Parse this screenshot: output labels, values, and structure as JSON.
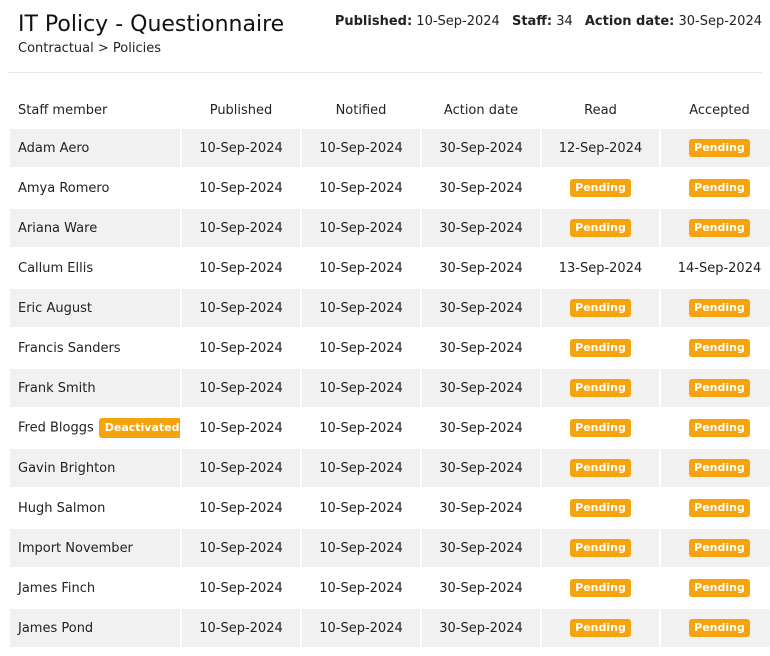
{
  "header": {
    "title": "IT Policy - Questionnaire",
    "breadcrumb": "Contractual > Policies",
    "published_label": "Published:",
    "published_value": "10-Sep-2024",
    "staff_label": "Staff:",
    "staff_value": "34",
    "action_label": "Action date:",
    "action_value": "30-Sep-2024"
  },
  "table": {
    "columns": [
      "Staff member",
      "Published",
      "Notified",
      "Action date",
      "Read",
      "Accepted"
    ],
    "rows": [
      {
        "name": "Adam Aero",
        "badge": "",
        "published": "10-Sep-2024",
        "notified": "10-Sep-2024",
        "action": "30-Sep-2024",
        "read": "12-Sep-2024",
        "read_pending": false,
        "accepted": "Pending",
        "accepted_pending": true
      },
      {
        "name": "Amya Romero",
        "badge": "",
        "published": "10-Sep-2024",
        "notified": "10-Sep-2024",
        "action": "30-Sep-2024",
        "read": "Pending",
        "read_pending": true,
        "accepted": "Pending",
        "accepted_pending": true
      },
      {
        "name": "Ariana Ware",
        "badge": "",
        "published": "10-Sep-2024",
        "notified": "10-Sep-2024",
        "action": "30-Sep-2024",
        "read": "Pending",
        "read_pending": true,
        "accepted": "Pending",
        "accepted_pending": true
      },
      {
        "name": "Callum Ellis",
        "badge": "",
        "published": "10-Sep-2024",
        "notified": "10-Sep-2024",
        "action": "30-Sep-2024",
        "read": "13-Sep-2024",
        "read_pending": false,
        "accepted": "14-Sep-2024",
        "accepted_pending": false
      },
      {
        "name": "Eric August",
        "badge": "",
        "published": "10-Sep-2024",
        "notified": "10-Sep-2024",
        "action": "30-Sep-2024",
        "read": "Pending",
        "read_pending": true,
        "accepted": "Pending",
        "accepted_pending": true
      },
      {
        "name": "Francis Sanders",
        "badge": "",
        "published": "10-Sep-2024",
        "notified": "10-Sep-2024",
        "action": "30-Sep-2024",
        "read": "Pending",
        "read_pending": true,
        "accepted": "Pending",
        "accepted_pending": true
      },
      {
        "name": "Frank Smith",
        "badge": "",
        "published": "10-Sep-2024",
        "notified": "10-Sep-2024",
        "action": "30-Sep-2024",
        "read": "Pending",
        "read_pending": true,
        "accepted": "Pending",
        "accepted_pending": true
      },
      {
        "name": "Fred Bloggs",
        "badge": "Deactivated",
        "published": "10-Sep-2024",
        "notified": "10-Sep-2024",
        "action": "30-Sep-2024",
        "read": "Pending",
        "read_pending": true,
        "accepted": "Pending",
        "accepted_pending": true
      },
      {
        "name": "Gavin Brighton",
        "badge": "",
        "published": "10-Sep-2024",
        "notified": "10-Sep-2024",
        "action": "30-Sep-2024",
        "read": "Pending",
        "read_pending": true,
        "accepted": "Pending",
        "accepted_pending": true
      },
      {
        "name": "Hugh Salmon",
        "badge": "",
        "published": "10-Sep-2024",
        "notified": "10-Sep-2024",
        "action": "30-Sep-2024",
        "read": "Pending",
        "read_pending": true,
        "accepted": "Pending",
        "accepted_pending": true
      },
      {
        "name": "Import November",
        "badge": "",
        "published": "10-Sep-2024",
        "notified": "10-Sep-2024",
        "action": "30-Sep-2024",
        "read": "Pending",
        "read_pending": true,
        "accepted": "Pending",
        "accepted_pending": true
      },
      {
        "name": "James Finch",
        "badge": "",
        "published": "10-Sep-2024",
        "notified": "10-Sep-2024",
        "action": "30-Sep-2024",
        "read": "Pending",
        "read_pending": true,
        "accepted": "Pending",
        "accepted_pending": true
      },
      {
        "name": "James Pond",
        "badge": "",
        "published": "10-Sep-2024",
        "notified": "10-Sep-2024",
        "action": "30-Sep-2024",
        "read": "Pending",
        "read_pending": true,
        "accepted": "Pending",
        "accepted_pending": true
      }
    ]
  },
  "colors": {
    "badge": "#f5a30e",
    "row_shade": "#f1f1f1"
  }
}
